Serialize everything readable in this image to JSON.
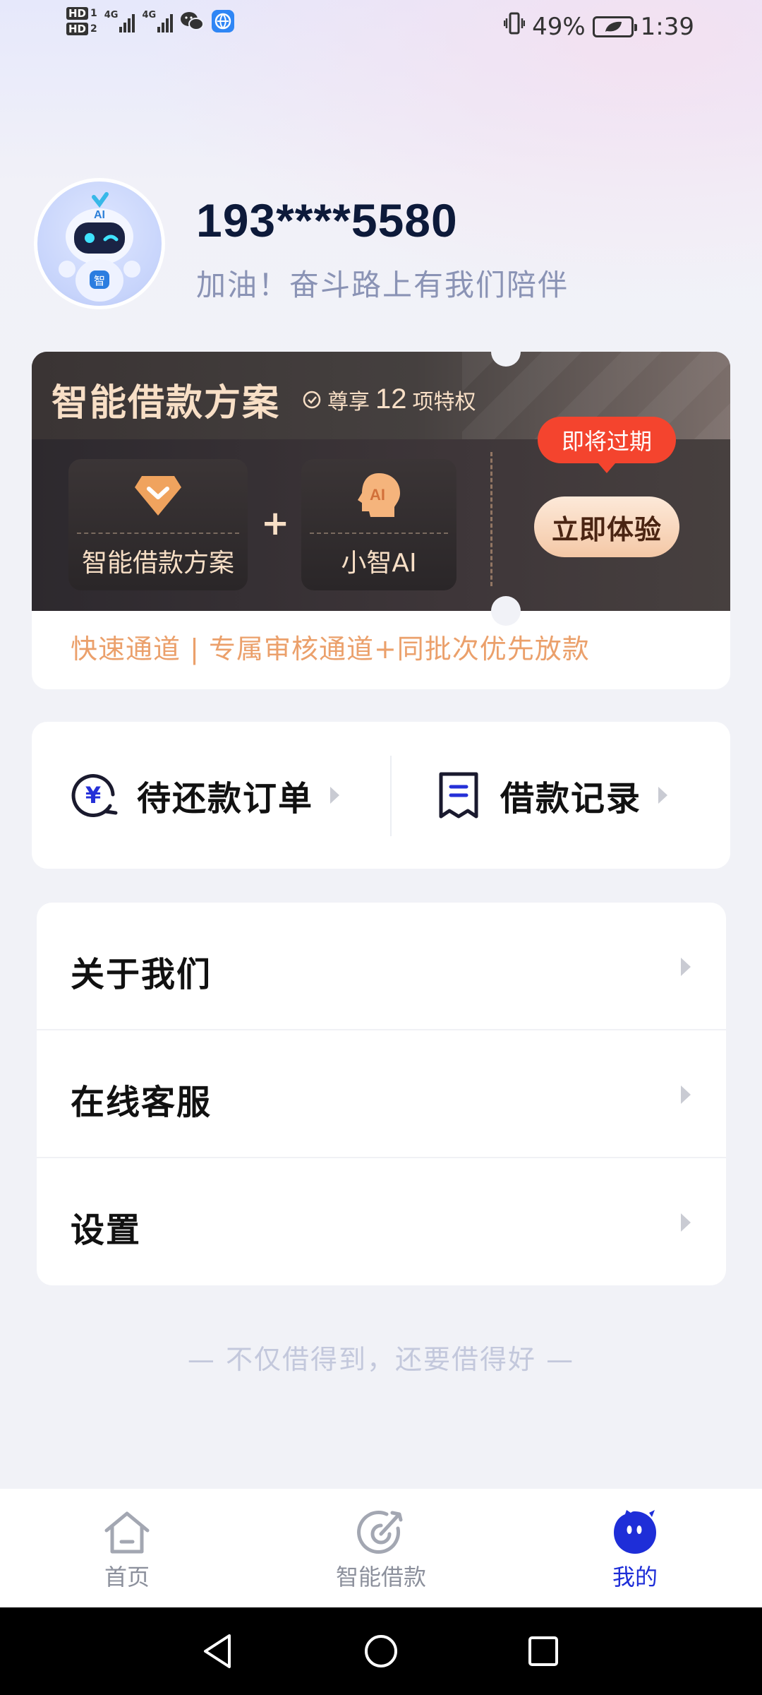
{
  "status_bar": {
    "hd1": "HD",
    "hd1_num": "1",
    "hd2": "HD",
    "hd2_num": "2",
    "net1": "4G",
    "net2": "4G",
    "battery_percent": "49%",
    "time": "1:39",
    "icons": [
      "wechat-icon",
      "browser-icon",
      "vibrate-icon",
      "battery-saver-icon"
    ]
  },
  "profile": {
    "phone": "193****5580",
    "slogan": "加油！奋斗路上有我们陪伴",
    "avatar_badge": "AI",
    "avatar_tag": "智"
  },
  "vip_card": {
    "title": "智能借款方案",
    "privilege_prefix": "尊享",
    "privilege_count": "12",
    "privilege_suffix": "项特权",
    "feature_1": "智能借款方案",
    "feature_2": "小智AI",
    "feature_2_badge": "AI",
    "plus": "+",
    "expire_badge": "即将过期",
    "try_button": "立即体验",
    "footer": "快速通道 | 专属审核通道+同批次优先放款"
  },
  "quick_actions": {
    "pending_repayment": "待还款订单",
    "loan_records": "借款记录",
    "repay_icon_glyph": "¥"
  },
  "menu": {
    "items": [
      {
        "label": "关于我们"
      },
      {
        "label": "在线客服"
      },
      {
        "label": "设置"
      }
    ]
  },
  "tagline": "— 不仅借得到，还要借得好 —",
  "tabbar": {
    "tabs": [
      {
        "label": "首页",
        "icon": "home-icon",
        "active": false
      },
      {
        "label": "智能借款",
        "icon": "target-icon",
        "active": false
      },
      {
        "label": "我的",
        "icon": "mascot-icon",
        "active": true
      }
    ],
    "active_color": "#1e2ed8"
  },
  "colors": {
    "accent": "#1e2ed8",
    "gold": "#f8dfc6",
    "expire_red": "#f4442e",
    "orange_text": "#eba06b"
  }
}
